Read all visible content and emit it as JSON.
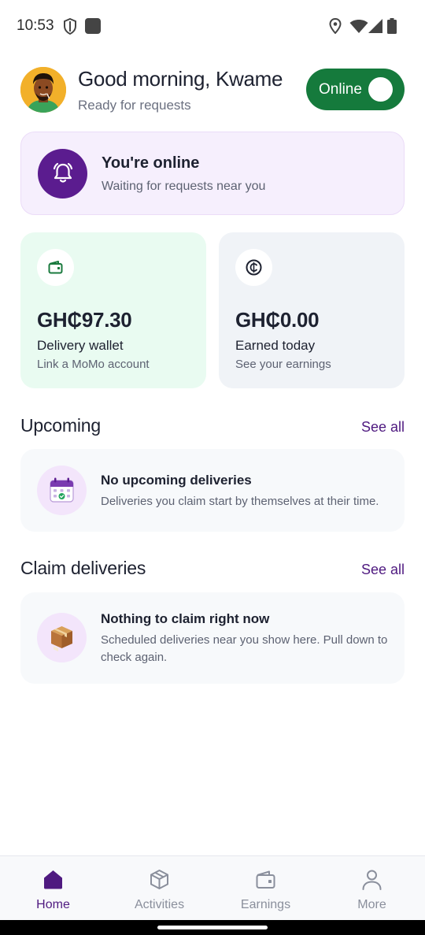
{
  "status_bar": {
    "time": "10:53"
  },
  "header": {
    "greeting": "Good morning, Kwame",
    "subtitle": "Ready for requests",
    "toggle_label": "Online",
    "toggle_on": true
  },
  "banner": {
    "title": "You're online",
    "subtitle": "Waiting for requests near you",
    "icon": "bell-icon"
  },
  "cards": [
    {
      "amount": "GH₵97.30",
      "label": "Delivery wallet",
      "sub": "Link a MoMo account",
      "icon": "wallet-icon",
      "bg": "#e9fbf1"
    },
    {
      "amount": "GH₵0.00",
      "label": "Earned today",
      "sub": "See your earnings",
      "icon": "cedi-coin-icon",
      "bg": "#f0f3f7"
    }
  ],
  "upcoming": {
    "title": "Upcoming",
    "see_all": "See all",
    "empty_title": "No upcoming deliveries",
    "empty_sub": "Deliveries you claim start by themselves at their time."
  },
  "claim": {
    "title": "Claim deliveries",
    "see_all": "See all",
    "empty_title": "Nothing to claim right now",
    "empty_sub": "Scheduled deliveries near you show here. Pull down to check again."
  },
  "nav": [
    {
      "label": "Home",
      "icon": "home-icon",
      "active": true
    },
    {
      "label": "Activities",
      "icon": "box-icon",
      "active": false
    },
    {
      "label": "Earnings",
      "icon": "wallet-icon",
      "active": false
    },
    {
      "label": "More",
      "icon": "person-icon",
      "active": false
    }
  ],
  "colors": {
    "accent": "#4f1a80",
    "online_green": "#157a3c",
    "banner_icon_bg": "#5b1c8f"
  }
}
